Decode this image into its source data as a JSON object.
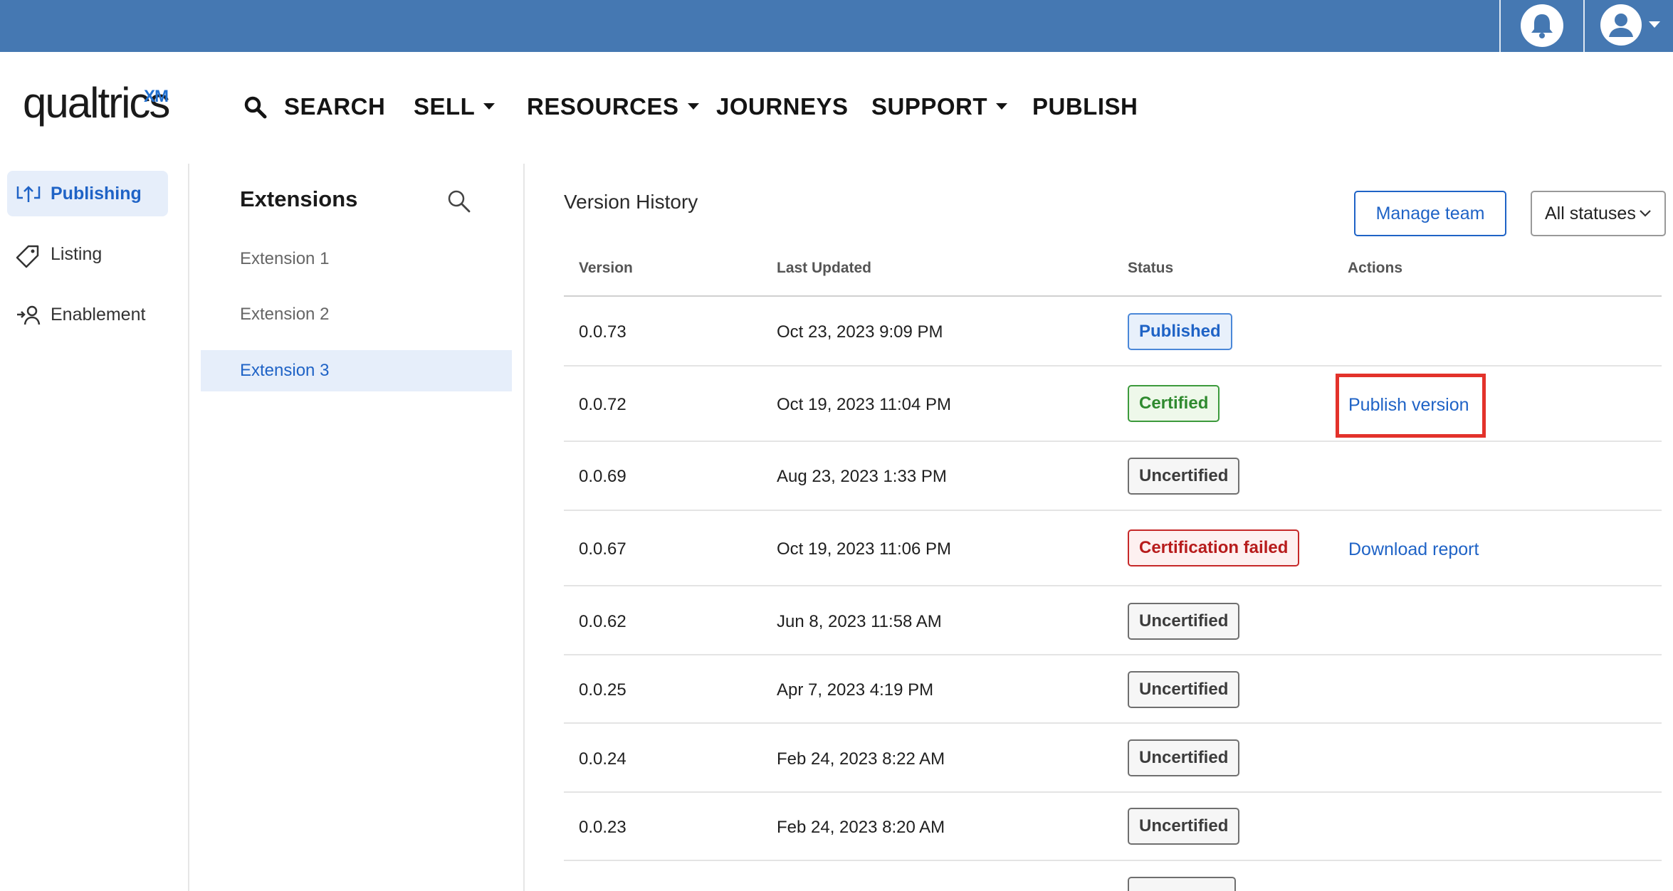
{
  "header": {
    "logo_text": "qualtrics",
    "logo_superscript": "XM",
    "nav": {
      "search": "SEARCH",
      "sell": "SELL",
      "resources": "RESOURCES",
      "journeys": "JOURNEYS",
      "support": "SUPPORT",
      "publish": "PUBLISH"
    }
  },
  "topbar": {
    "notification_icon": "bell-icon",
    "user_icon": "user-avatar-icon",
    "color": "#4578b2"
  },
  "sidebar": {
    "items": [
      {
        "label": "Publishing",
        "icon": "publishing-icon",
        "active": true
      },
      {
        "label": "Listing",
        "icon": "tag-icon",
        "active": false
      },
      {
        "label": "Enablement",
        "icon": "user-arrow-icon",
        "active": false
      }
    ]
  },
  "extensions": {
    "title": "Extensions",
    "items": [
      {
        "label": "Extension 1",
        "active": false
      },
      {
        "label": "Extension 2",
        "active": false
      },
      {
        "label": "Extension 3",
        "active": true
      }
    ]
  },
  "main": {
    "title": "Version History",
    "manage_team_label": "Manage team",
    "status_filter_value": "All statuses",
    "columns": [
      "Version",
      "Last Updated",
      "Status",
      "Actions"
    ],
    "rows": [
      {
        "version": "0.0.73",
        "updated": "Oct 23, 2023 9:09 PM",
        "status": "Published",
        "action": ""
      },
      {
        "version": "0.0.72",
        "updated": "Oct 19, 2023 11:04 PM",
        "status": "Certified",
        "action": "Publish version"
      },
      {
        "version": "0.0.69",
        "updated": "Aug 23, 2023 1:33 PM",
        "status": "Uncertified",
        "action": ""
      },
      {
        "version": "0.0.67",
        "updated": "Oct 19, 2023 11:06 PM",
        "status": "Certification failed",
        "action": "Download report"
      },
      {
        "version": "0.0.62",
        "updated": "Jun 8, 2023 11:58 AM",
        "status": "Uncertified",
        "action": ""
      },
      {
        "version": "0.0.25",
        "updated": "Apr 7, 2023 4:19 PM",
        "status": "Uncertified",
        "action": ""
      },
      {
        "version": "0.0.24",
        "updated": "Feb 24, 2023 8:22 AM",
        "status": "Uncertified",
        "action": ""
      },
      {
        "version": "0.0.23",
        "updated": "Feb 24, 2023 8:20 AM",
        "status": "Uncertified",
        "action": ""
      }
    ]
  },
  "colors": {
    "accent_blue": "#1f63c6",
    "highlight_red": "#e3322b",
    "certified_green": "#2f8a2f",
    "failed_red": "#b71c1c"
  }
}
